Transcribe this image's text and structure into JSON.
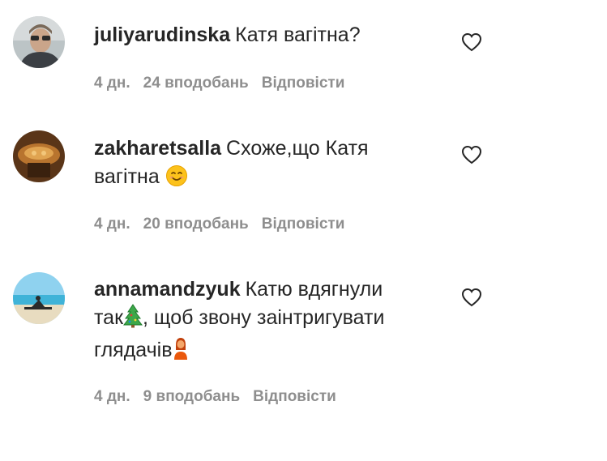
{
  "comments": [
    {
      "username": "juliyarudinska",
      "text": "Катя вагітна?",
      "time": "4 дн.",
      "likes": "24 вподобань",
      "reply": "Відповісти"
    },
    {
      "username": "zakharetsalla",
      "text_before": "Схоже,що Катя",
      "text_after": "вагітна",
      "emoji": "smiling-face-icon",
      "time": "4 дн.",
      "likes": "20 вподобань",
      "reply": "Відповісти"
    },
    {
      "username": "annamandzyuk",
      "text_line1": "Катю вдягнули",
      "text_line2_a": "так",
      "text_line2_b": ", щоб звону заінтригувати",
      "text_line3": "глядачів",
      "emoji_1": "christmas-tree-icon",
      "emoji_2": "woman-icon",
      "time": "4 дн.",
      "likes": "9 вподобань",
      "reply": "Відповісти"
    }
  ],
  "colors": {
    "text": "#262626",
    "meta": "#8e8e8e"
  }
}
